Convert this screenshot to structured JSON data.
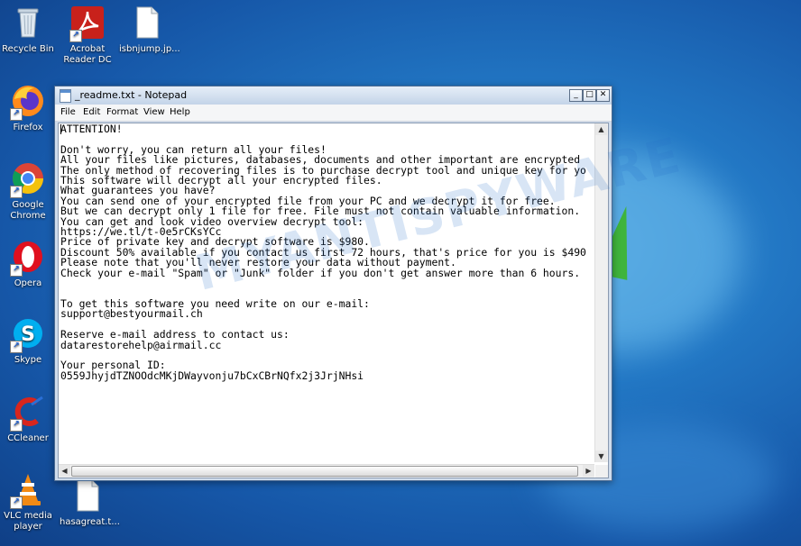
{
  "desktop": {
    "watermark": "MYANTISPYWARE",
    "icons": [
      {
        "label": "Recycle Bin",
        "icon": "recycle-bin-icon"
      },
      {
        "label": "Acrobat Reader DC",
        "icon": "acrobat-icon"
      },
      {
        "label": "isbnjump.jp...",
        "icon": "file-icon"
      },
      {
        "label": "Firefox",
        "icon": "firefox-icon"
      },
      {
        "label": "Google Chrome",
        "icon": "chrome-icon"
      },
      {
        "label": "Opera",
        "icon": "opera-icon"
      },
      {
        "label": "Skype",
        "icon": "skype-icon"
      },
      {
        "label": "CCleaner",
        "icon": "ccleaner-icon"
      },
      {
        "label": "VLC media player",
        "icon": "vlc-icon"
      },
      {
        "label": "hasagreat.t...",
        "icon": "file-icon"
      }
    ]
  },
  "notepad": {
    "title": "_readme.txt - Notepad",
    "buttons": {
      "minimize": "_",
      "maximize": "□",
      "close": "✕"
    },
    "menu": [
      "File",
      "Edit",
      "Format",
      "View",
      "Help"
    ],
    "content": "ATTENTION!\n\nDon't worry, you can return all your files!\nAll your files like pictures, databases, documents and other important are encrypted\nThe only method of recovering files is to purchase decrypt tool and unique key for yo\nThis software will decrypt all your encrypted files.\nWhat guarantees you have?\nYou can send one of your encrypted file from your PC and we decrypt it for free.\nBut we can decrypt only 1 file for free. File must not contain valuable information.\nYou can get and look video overview decrypt tool:\nhttps://we.tl/t-0e5rCKsYCc\nPrice of private key and decrypt software is $980.\nDiscount 50% available if you contact us first 72 hours, that's price for you is $490\nPlease note that you'll never restore your data without payment.\nCheck your e-mail \"Spam\" or \"Junk\" folder if you don't get answer more than 6 hours.\n\n\nTo get this software you need write on our e-mail:\nsupport@bestyourmail.ch\n\nReserve e-mail address to contact us:\ndatarestorehelp@airmail.cc\n\nYour personal ID:\n0559JhyjdTZNOOdcMKjDWayvonju7bCxCBrNQfx2j3JrjNHsi"
  },
  "colors": {
    "accent": "#1657a8",
    "window_border": "#4a6a92"
  }
}
